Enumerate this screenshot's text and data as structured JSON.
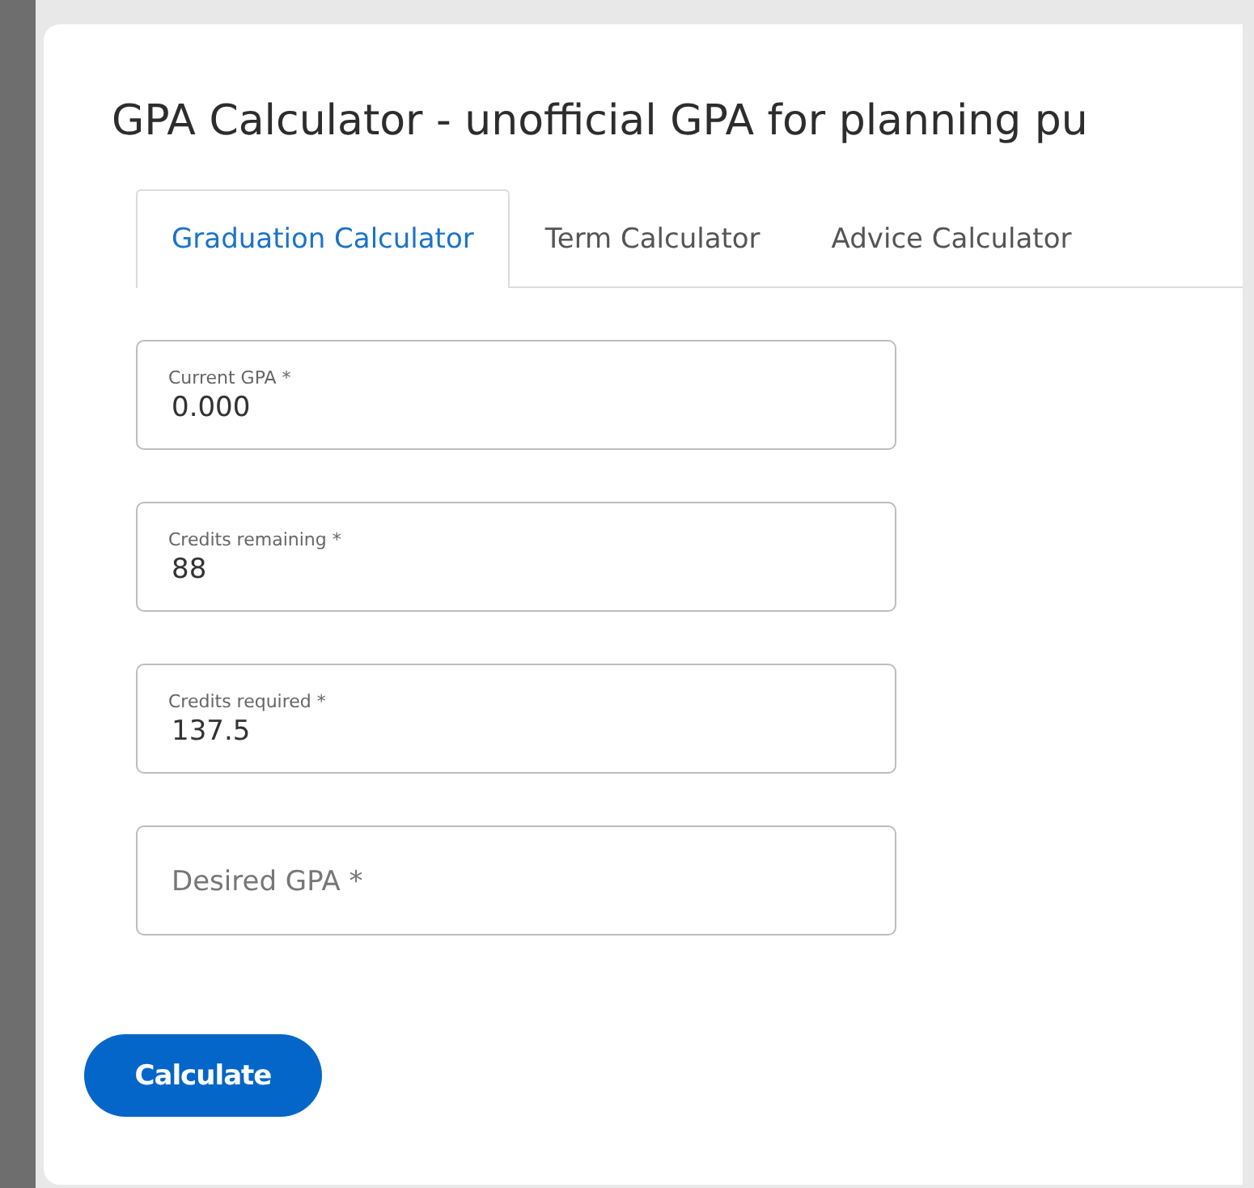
{
  "dialog": {
    "title": "GPA Calculator - unofficial GPA for planning pu"
  },
  "tabs": [
    {
      "label": "Graduation Calculator",
      "selected": true
    },
    {
      "label": "Term Calculator",
      "selected": false
    },
    {
      "label": "Advice Calculator",
      "selected": false
    }
  ],
  "fields": [
    {
      "label": "Current GPA *",
      "value": "0.000"
    },
    {
      "label": "Credits remaining *",
      "value": "88"
    },
    {
      "label": "Credits required *",
      "value": "137.5"
    },
    {
      "placeholder": "Desired GPA *"
    }
  ],
  "buttons": [
    "Calculate"
  ]
}
